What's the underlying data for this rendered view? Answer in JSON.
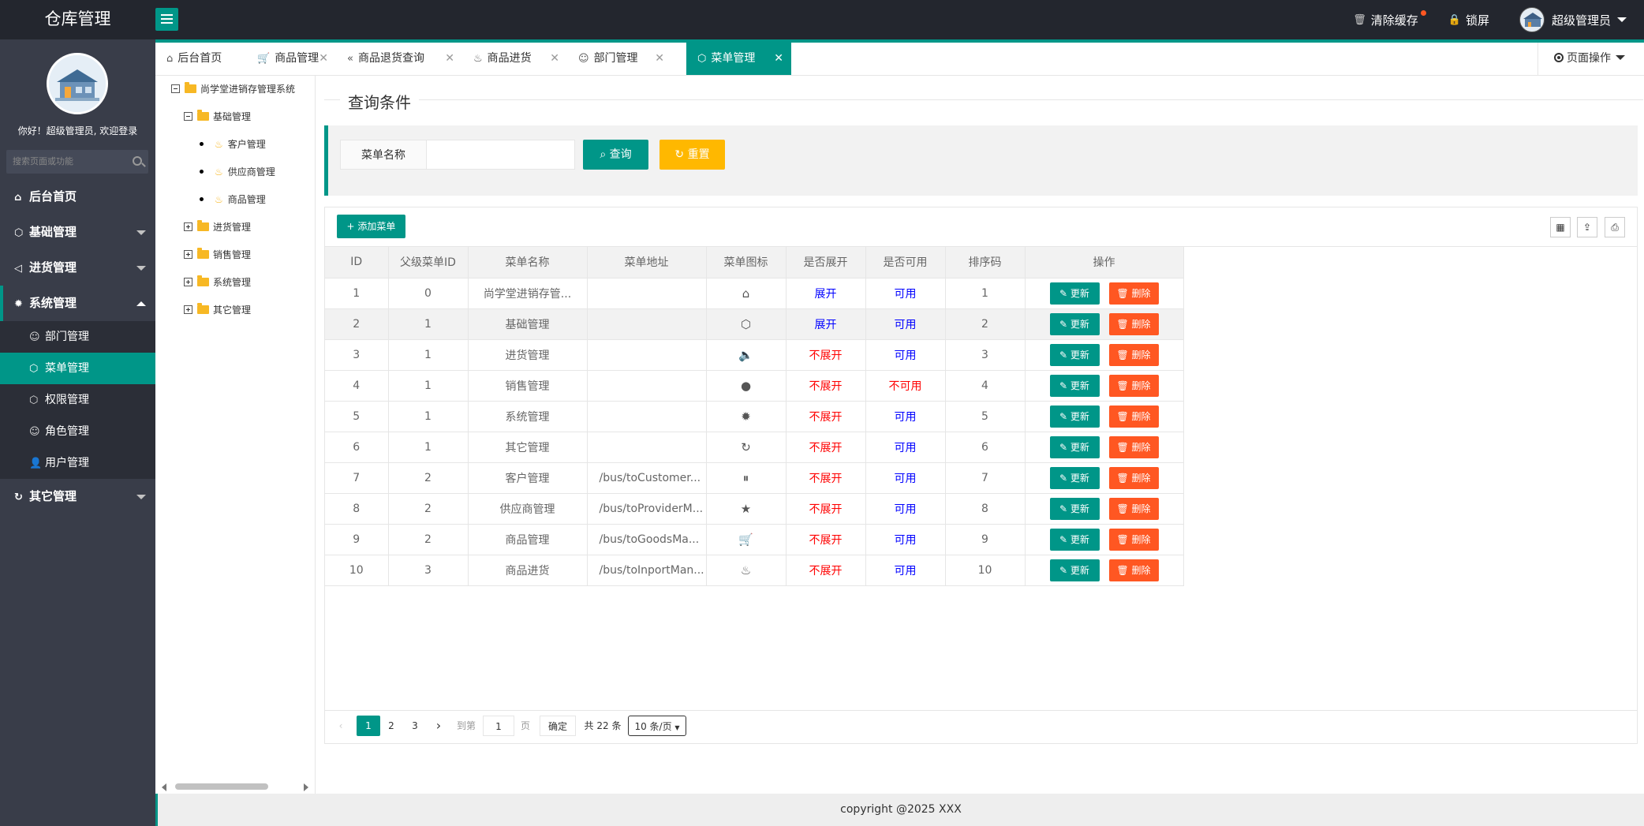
{
  "app": {
    "title": "仓库管理"
  },
  "header": {
    "clear_cache": "清除缓存",
    "lock_screen": "锁屏",
    "user_name": "超级管理员"
  },
  "sidebar": {
    "welcome": "你好！超级管理员, 欢迎登录",
    "search_placeholder": "搜索页面或功能",
    "items": [
      {
        "label": "后台首页",
        "icon": "home-icon"
      },
      {
        "label": "基础管理",
        "icon": "cube-icon"
      },
      {
        "label": "进货管理",
        "icon": "speaker-icon"
      },
      {
        "label": "系统管理",
        "icon": "gear-icon"
      },
      {
        "label": "其它管理",
        "icon": "loop-icon"
      }
    ],
    "sub_items": [
      {
        "label": "部门管理",
        "icon": "user-icon"
      },
      {
        "label": "菜单管理",
        "icon": "cube-icon"
      },
      {
        "label": "权限管理",
        "icon": "cube-icon"
      },
      {
        "label": "角色管理",
        "icon": "smile-icon"
      },
      {
        "label": "用户管理",
        "icon": "person-icon"
      }
    ]
  },
  "tabs": [
    {
      "label": "后台首页"
    },
    {
      "label": "商品管理"
    },
    {
      "label": "商品退货查询"
    },
    {
      "label": "商品进货"
    },
    {
      "label": "部门管理"
    },
    {
      "label": "菜单管理"
    }
  ],
  "page_op": "页面操作",
  "tree": {
    "root": "尚学堂进销存管理系统",
    "basic": "基础管理",
    "leaves": [
      "客户管理",
      "供应商管理",
      "商品管理"
    ],
    "others": [
      "进货管理",
      "销售管理",
      "系统管理",
      "其它管理"
    ]
  },
  "query": {
    "legend": "查询条件",
    "label": "菜单名称",
    "input_value": "",
    "search_btn": "查询",
    "reset_btn": "重置"
  },
  "toolbar": {
    "add_btn": "添加菜单"
  },
  "table": {
    "headers": [
      "ID",
      "父级菜单ID",
      "菜单名称",
      "菜单地址",
      "菜单图标",
      "是否展开",
      "是否可用",
      "排序码",
      "操作"
    ],
    "update_label": "更新",
    "delete_label": "删除",
    "rows": [
      {
        "id": "1",
        "pid": "0",
        "name": "尚学堂进销存管...",
        "url": "",
        "icon": "⌂",
        "spread": "展开",
        "available": "可用",
        "order": "1"
      },
      {
        "id": "2",
        "pid": "1",
        "name": "基础管理",
        "url": "",
        "icon": "⬡",
        "spread": "展开",
        "available": "可用",
        "order": "2"
      },
      {
        "id": "3",
        "pid": "1",
        "name": "进货管理",
        "url": "",
        "icon": "🔈",
        "spread": "不展开",
        "available": "可用",
        "order": "3"
      },
      {
        "id": "4",
        "pid": "1",
        "name": "销售管理",
        "url": "",
        "icon": "●",
        "spread": "不展开",
        "available": "不可用",
        "order": "4"
      },
      {
        "id": "5",
        "pid": "1",
        "name": "系统管理",
        "url": "",
        "icon": "✹",
        "spread": "不展开",
        "available": "可用",
        "order": "5"
      },
      {
        "id": "6",
        "pid": "1",
        "name": "其它管理",
        "url": "",
        "icon": "↻",
        "spread": "不展开",
        "available": "可用",
        "order": "6"
      },
      {
        "id": "7",
        "pid": "2",
        "name": "客户管理",
        "url": "/bus/toCustomer...",
        "icon": "⏸",
        "spread": "不展开",
        "available": "可用",
        "order": "7"
      },
      {
        "id": "8",
        "pid": "2",
        "name": "供应商管理",
        "url": "/bus/toProviderM...",
        "icon": "★",
        "spread": "不展开",
        "available": "可用",
        "order": "8"
      },
      {
        "id": "9",
        "pid": "2",
        "name": "商品管理",
        "url": "/bus/toGoodsMa...",
        "icon": "🛒",
        "spread": "不展开",
        "available": "可用",
        "order": "9"
      },
      {
        "id": "10",
        "pid": "3",
        "name": "商品进货",
        "url": "/bus/toInportMan...",
        "icon": "♨",
        "spread": "不展开",
        "available": "可用",
        "order": "10"
      }
    ]
  },
  "pager": {
    "pages": [
      "1",
      "2",
      "3"
    ],
    "goto_label": "到第",
    "page_input": "1",
    "page_unit": "页",
    "confirm": "确定",
    "total": "共 22 条",
    "per_page": "10 条/页"
  },
  "footer": "copyright @2025 XXX"
}
